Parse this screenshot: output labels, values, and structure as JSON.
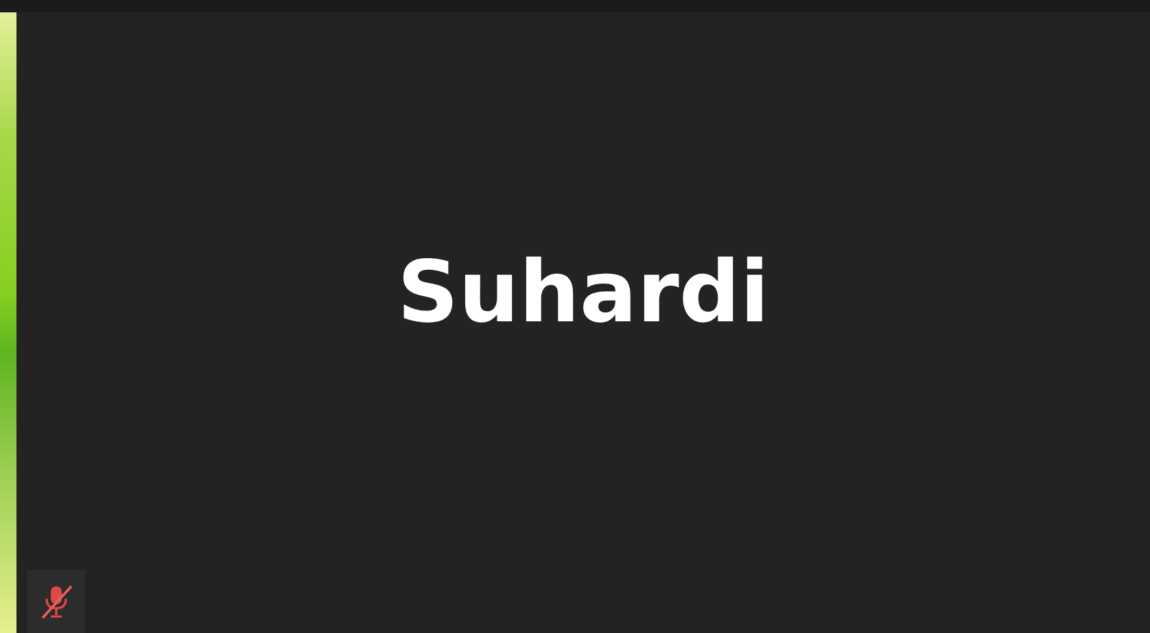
{
  "participant": {
    "name": "Suhardi",
    "speaking": true,
    "muted": true
  }
}
